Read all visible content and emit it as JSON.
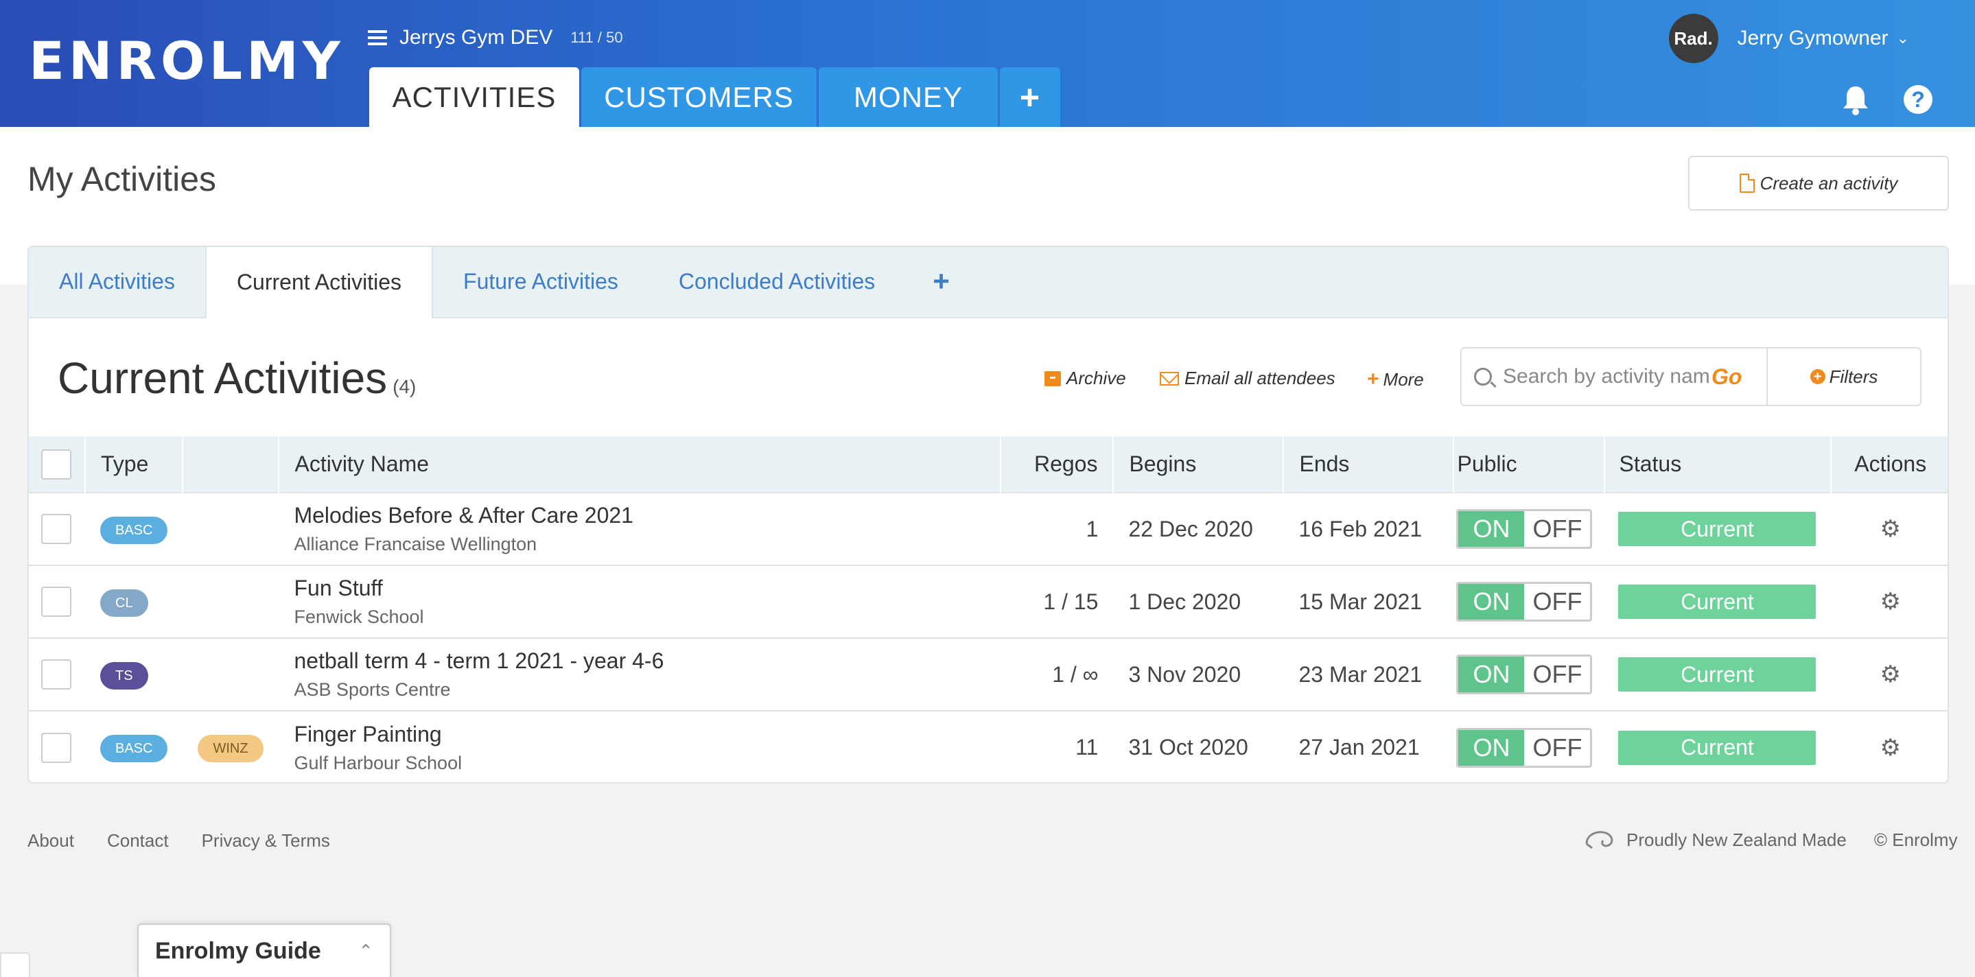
{
  "brand": {
    "logo_text": "ENROLMY",
    "accent": "#2f86da",
    "orange": "#f08a1d",
    "green": "#6ed29b"
  },
  "org": {
    "name": "Jerrys Gym DEV",
    "count": "111 / 50"
  },
  "main_tabs": [
    {
      "label": "ACTIVITIES",
      "active": true
    },
    {
      "label": "CUSTOMERS"
    },
    {
      "label": "MONEY"
    },
    {
      "label": "+"
    }
  ],
  "user": {
    "avatar": "Rad.",
    "name": "Jerry Gymowner",
    "caret": "⌄"
  },
  "help_label": "?",
  "page": {
    "title": "My Activities",
    "create_button": "Create an activity"
  },
  "subtabs": [
    {
      "label": "All Activities"
    },
    {
      "label": "Current Activities",
      "active": true
    },
    {
      "label": "Future Activities"
    },
    {
      "label": "Concluded Activities"
    },
    {
      "label": "+"
    }
  ],
  "section": {
    "title": "Current Activities",
    "count": "(4)",
    "archive": "Archive",
    "email": "Email all attendees",
    "more": "More",
    "search_placeholder": "Search by activity name",
    "go": "Go",
    "filters": "Filters"
  },
  "table": {
    "headers": {
      "type": "Type",
      "name": "Activity Name",
      "regos": "Regos",
      "begins": "Begins",
      "ends": "Ends",
      "public": "Public",
      "status": "Status",
      "actions": "Actions"
    },
    "rows": [
      {
        "type": "BASC",
        "type_color": "#5aaee0",
        "tag": "",
        "name": "Melodies Before & After Care 2021",
        "venue": "Alliance Francaise Wellington",
        "regos": "1",
        "begins": "22 Dec 2020",
        "ends": "16 Feb 2021",
        "on": "ON",
        "off": "OFF",
        "status": "Current"
      },
      {
        "type": "CL",
        "type_color": "#84a9c8",
        "tag": "",
        "name": "Fun Stuff",
        "venue": "Fenwick School",
        "regos": "1 / 15",
        "begins": "1 Dec 2020",
        "ends": "15 Mar 2021",
        "on": "ON",
        "off": "OFF",
        "status": "Current"
      },
      {
        "type": "TS",
        "type_color": "#5a4f98",
        "tag": "",
        "name": "netball term 4 - term 1 2021 - year 4-6",
        "venue": "ASB Sports Centre",
        "regos": "1 / ∞",
        "begins": "3 Nov 2020",
        "ends": "23 Mar 2021",
        "on": "ON",
        "off": "OFF",
        "status": "Current"
      },
      {
        "type": "BASC",
        "type_color": "#5aaee0",
        "tag": "WINZ",
        "tag_color": "#f2c882",
        "name": "Finger Painting",
        "venue": "Gulf Harbour School",
        "regos": "11",
        "begins": "31 Oct 2020",
        "ends": "27 Jan 2021",
        "on": "ON",
        "off": "OFF",
        "status": "Current"
      }
    ]
  },
  "footer": {
    "links": [
      "About",
      "Contact",
      "Privacy & Terms"
    ],
    "made_in": "Proudly New Zealand Made",
    "copyright": "© Enrolmy"
  },
  "guide": {
    "title": "Enrolmy Guide",
    "caret": "⌃"
  }
}
